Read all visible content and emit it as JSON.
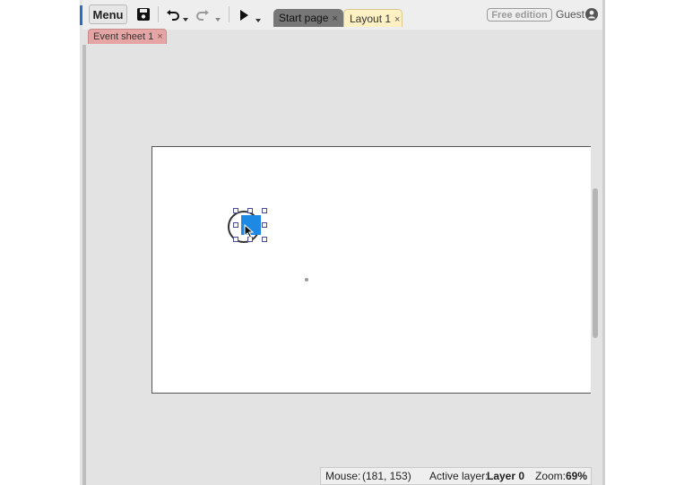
{
  "toolbar": {
    "menu_label": "Menu",
    "icons": [
      "save-icon",
      "undo-icon",
      "redo-icon",
      "play-icon"
    ]
  },
  "tabs": [
    {
      "label": "Start page",
      "close": "×",
      "active": false
    },
    {
      "label": "Layout 1",
      "close": "×",
      "active": true
    }
  ],
  "subtabs": [
    {
      "label": "Event sheet 1",
      "close": "×"
    }
  ],
  "account": {
    "edition_badge": "Free edition",
    "user_label": "Guest"
  },
  "status": {
    "mouse_label": "Mouse:",
    "mouse_value": "(181, 153)",
    "layer_label": "Active layer:",
    "layer_value": "Layer 0",
    "zoom_label": "Zoom:",
    "zoom_value": "69%"
  },
  "colors": {
    "tab_active": "#fdf0c2",
    "tab_inactive": "#777777",
    "event_tab": "#e6a5a5",
    "sprite_blue": "#1e88e5"
  }
}
